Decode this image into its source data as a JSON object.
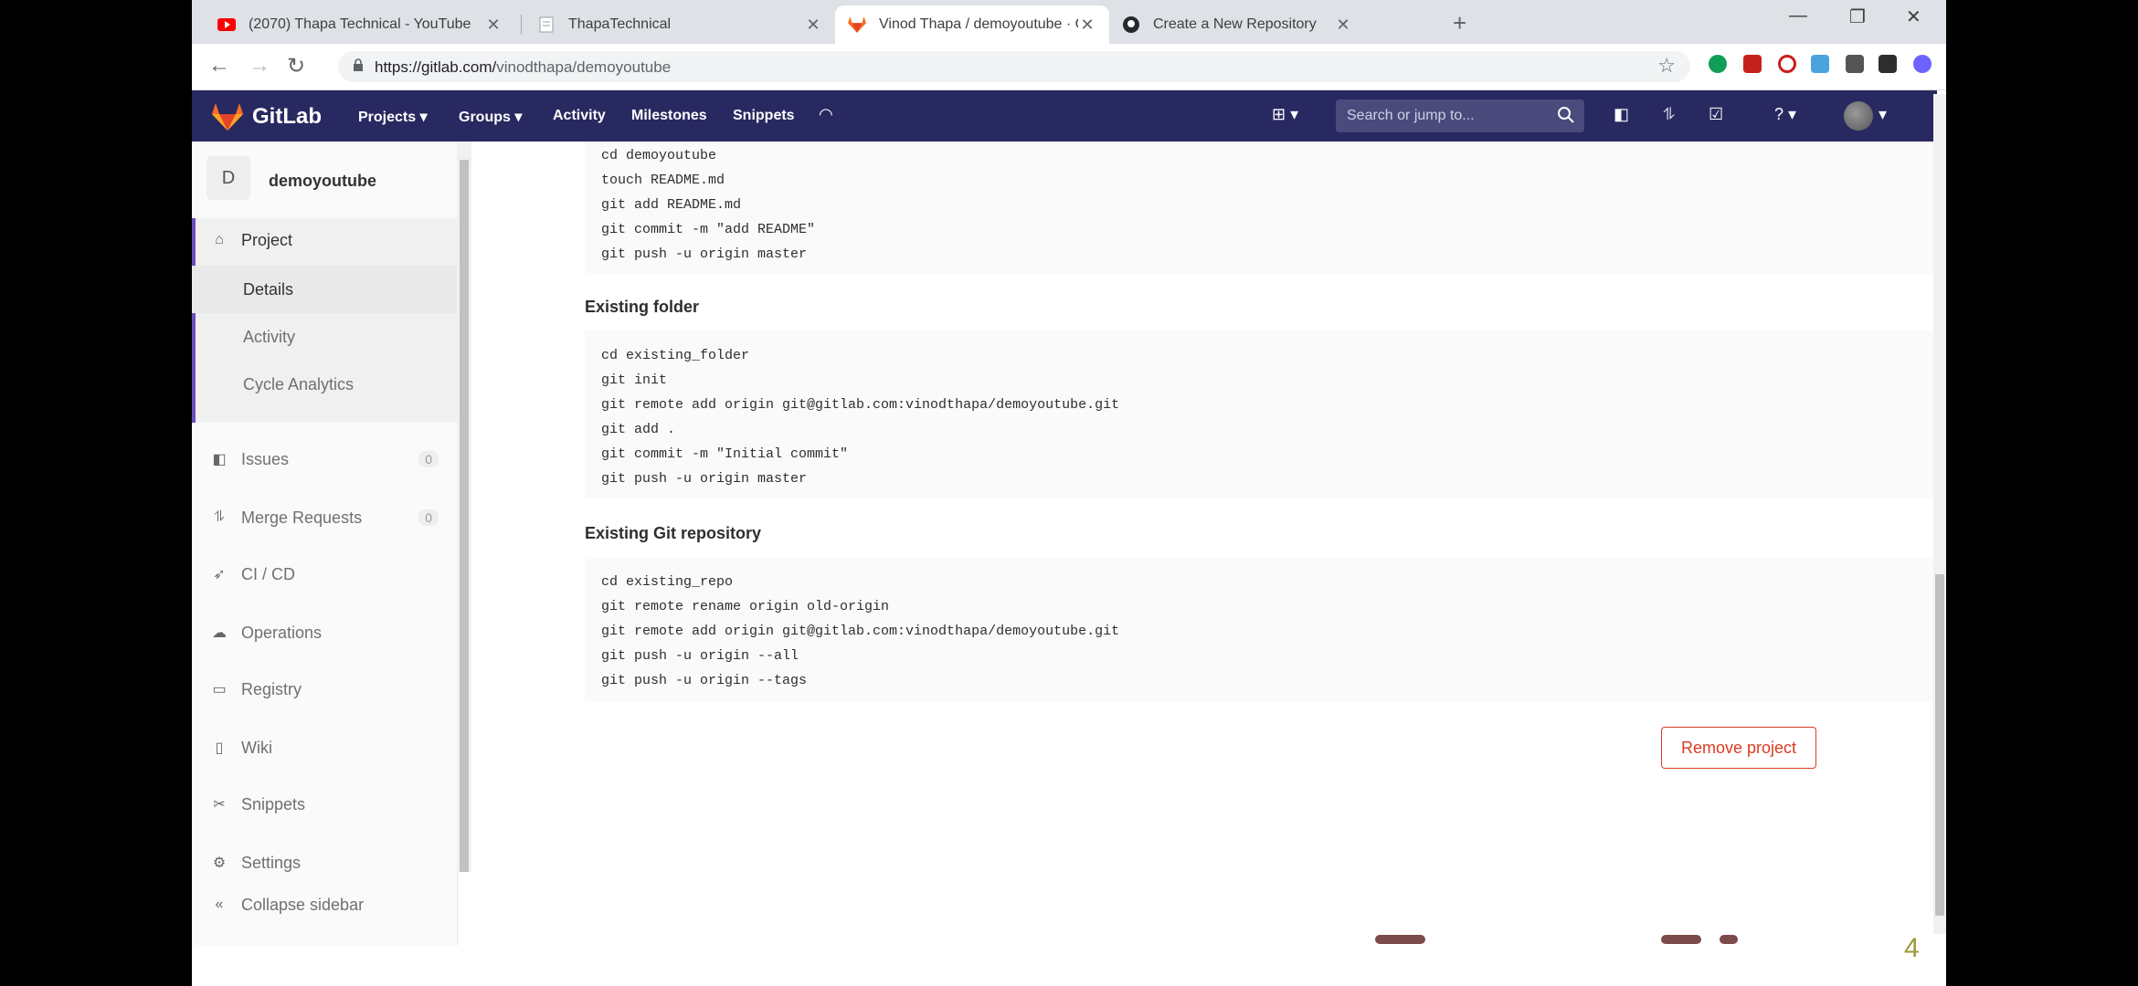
{
  "browser": {
    "tabs": [
      {
        "title": "(2070) Thapa Technical - YouTube",
        "icon": "youtube-icon",
        "active": false
      },
      {
        "title": "ThapaTechnical",
        "icon": "page-icon",
        "active": false
      },
      {
        "title": "Vinod Thapa / demoyoutube · GitLab",
        "icon": "gitlab-icon",
        "active": true
      },
      {
        "title": "Create a New Repository",
        "icon": "github-icon",
        "active": false
      }
    ],
    "new_tab": "+",
    "url_host": "https://gitlab.com/",
    "url_path": "vinodthapa/demoyoutube"
  },
  "gitlab_nav": {
    "brand": "GitLab",
    "items": [
      "Projects ▾",
      "Groups ▾",
      "Activity",
      "Milestones",
      "Snippets"
    ],
    "search_placeholder": "Search or jump to..."
  },
  "sidebar": {
    "project_initial": "D",
    "project_name": "demoyoutube",
    "project_label": "Project",
    "sub_items": [
      "Details",
      "Activity",
      "Cycle Analytics"
    ],
    "items": [
      {
        "label": "Issues",
        "count": "0"
      },
      {
        "label": "Merge Requests",
        "count": "0"
      },
      {
        "label": "CI / CD"
      },
      {
        "label": "Operations"
      },
      {
        "label": "Registry"
      },
      {
        "label": "Wiki"
      },
      {
        "label": "Snippets"
      },
      {
        "label": "Settings"
      }
    ],
    "collapse": "Collapse sidebar"
  },
  "main": {
    "top_code": [
      "cd demoyoutube",
      "touch README.md",
      "git add README.md",
      "git commit -m \"add README\"",
      "git push -u origin master"
    ],
    "existing_folder_heading": "Existing folder",
    "existing_folder_code": [
      "cd existing_folder",
      "git init",
      "git remote add origin git@gitlab.com:vinodthapa/demoyoutube.git",
      "git add .",
      "git commit -m \"Initial commit\"",
      "git push -u origin master"
    ],
    "existing_repo_heading": "Existing Git repository",
    "existing_repo_code": [
      "cd existing_repo",
      "git remote rename origin old-origin",
      "git remote add origin git@gitlab.com:vinodthapa/demoyoutube.git",
      "git push -u origin --all",
      "git push -u origin --tags"
    ],
    "remove_button": "Remove project"
  },
  "overlay_number": "4",
  "colors": {
    "navbar": "#292961",
    "accent": "#6b4fbb",
    "danger": "#db3b21"
  }
}
